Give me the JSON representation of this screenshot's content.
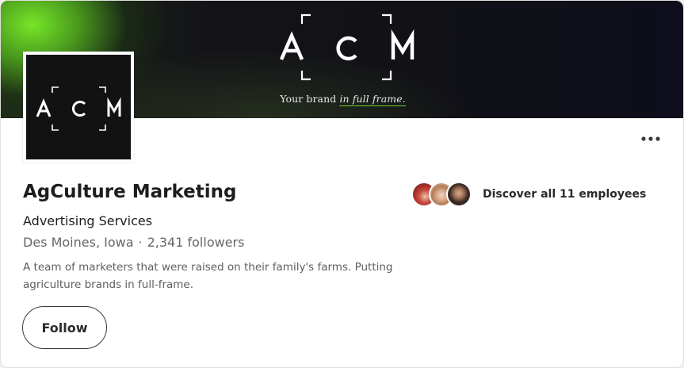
{
  "banner": {
    "logo_text": "ACM",
    "tagline_prefix": "Your brand",
    "tagline_emphasis": "in full frame.",
    "accent_color": "#6fd22b"
  },
  "profile_logo": {
    "logo_text": "ACM"
  },
  "company": {
    "name": "AgCulture Marketing",
    "industry": "Advertising Services",
    "location": "Des Moines, Iowa",
    "separator": "·",
    "followers": "2,341 followers",
    "about": "A team of marketers that were raised on their family's farms. Putting agriculture brands in full-frame."
  },
  "employees": {
    "label": "Discover all 11 employees",
    "avatars": [
      "employee-avatar-1",
      "employee-avatar-2",
      "employee-avatar-3"
    ]
  },
  "actions": {
    "follow_label": "Follow",
    "more_icon": "ellipsis-icon"
  }
}
